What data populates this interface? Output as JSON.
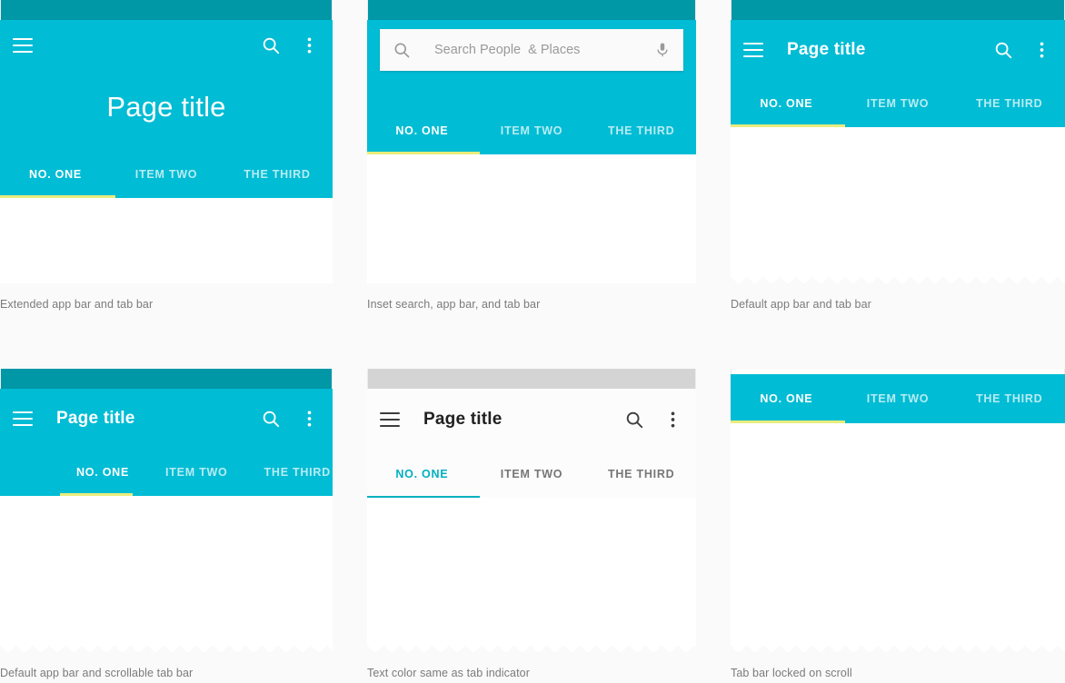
{
  "tabs": {
    "labels": [
      "NO. ONE",
      "ITEM TWO",
      "THE THIRD"
    ],
    "active_index": 0
  },
  "colors": {
    "app_bar_teal": "#00BCD4",
    "status_bar_teal": "#0097A7",
    "indicator_yellow": "#E9EC7C",
    "indicator_teal": "#00B0C0",
    "status_bar_gray": "#D4D4D4",
    "page_background": "#FAFAFA",
    "caption_text": "#7B7B7B"
  },
  "cards": [
    {
      "id": "extended-app-bar",
      "caption": "Extended app bar and tab bar",
      "title": "Page title",
      "menu_icon": "hamburger-icon",
      "search_icon": "search-icon",
      "overflow_icon": "more-vert-icon",
      "tabs": [
        "NO. ONE",
        "ITEM TWO",
        "THE THIRD"
      ],
      "active_tab": "NO. ONE"
    },
    {
      "id": "inset-search-app-bar",
      "caption": "Inset search, app bar, and tab bar",
      "search_placeholder": "Search People  & Places",
      "search_icon": "search-icon",
      "mic_icon": "microphone-icon",
      "tabs": [
        "NO. ONE",
        "ITEM TWO",
        "THE THIRD"
      ],
      "active_tab": "NO. ONE"
    },
    {
      "id": "default-app-bar",
      "caption": "Default app bar and tab bar",
      "title": "Page title",
      "menu_icon": "hamburger-icon",
      "search_icon": "search-icon",
      "overflow_icon": "more-vert-icon",
      "tabs": [
        "NO. ONE",
        "ITEM TWO",
        "THE THIRD"
      ],
      "active_tab": "NO. ONE"
    },
    {
      "id": "scrollable-tab-bar",
      "caption": "Default app bar and scrollable tab bar",
      "title": "Page title",
      "menu_icon": "hamburger-icon",
      "search_icon": "search-icon",
      "overflow_icon": "more-vert-icon",
      "tabs": [
        "NO. ONE",
        "ITEM TWO",
        "THE THIRD"
      ],
      "active_tab": "NO. ONE"
    },
    {
      "id": "light-app-bar",
      "caption": "Text color same as tab indicator",
      "title": "Page title",
      "menu_icon": "hamburger-icon",
      "search_icon": "search-icon",
      "overflow_icon": "more-vert-icon",
      "tabs": [
        "NO. ONE",
        "ITEM TWO",
        "THE THIRD"
      ],
      "active_tab": "NO. ONE"
    },
    {
      "id": "tab-bar-locked",
      "caption": "Tab bar locked on scroll",
      "tabs": [
        "NO. ONE",
        "ITEM TWO",
        "THE THIRD"
      ],
      "active_tab": "NO. ONE"
    }
  ]
}
